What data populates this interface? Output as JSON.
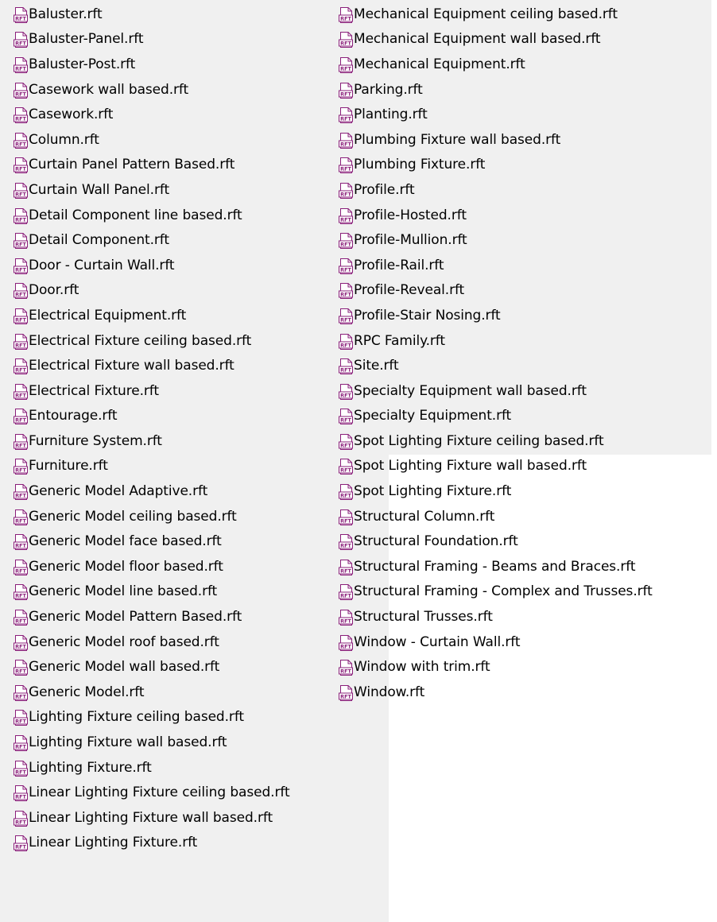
{
  "icon": {
    "name": "rft-file-icon",
    "badge": "RFT",
    "accent": "#8a1f7a"
  },
  "columns": [
    {
      "items": [
        "Baluster.rft",
        "Baluster-Panel.rft",
        "Baluster-Post.rft",
        "Casework wall based.rft",
        "Casework.rft",
        "Column.rft",
        "Curtain Panel Pattern Based.rft",
        "Curtain Wall Panel.rft",
        "Detail Component line based.rft",
        "Detail Component.rft",
        "Door - Curtain Wall.rft",
        "Door.rft",
        "Electrical Equipment.rft",
        "Electrical Fixture ceiling based.rft",
        "Electrical Fixture wall based.rft",
        "Electrical Fixture.rft",
        "Entourage.rft",
        "Furniture System.rft",
        "Furniture.rft",
        "Generic Model Adaptive.rft",
        "Generic Model ceiling based.rft",
        "Generic Model face based.rft",
        "Generic Model floor based.rft",
        "Generic Model line based.rft",
        "Generic Model Pattern Based.rft",
        "Generic Model roof based.rft",
        "Generic Model wall based.rft",
        "Generic Model.rft",
        "Lighting Fixture ceiling based.rft",
        "Lighting Fixture wall based.rft",
        "Lighting Fixture.rft",
        "Linear Lighting Fixture ceiling based.rft",
        "Linear Lighting Fixture wall based.rft",
        "Linear Lighting Fixture.rft"
      ]
    },
    {
      "items": [
        "Mechanical Equipment ceiling based.rft",
        "Mechanical Equipment wall based.rft",
        "Mechanical Equipment.rft",
        "Parking.rft",
        "Planting.rft",
        "Plumbing Fixture wall based.rft",
        "Plumbing Fixture.rft",
        "Profile.rft",
        "Profile-Hosted.rft",
        "Profile-Mullion.rft",
        "Profile-Rail.rft",
        "Profile-Reveal.rft",
        "Profile-Stair Nosing.rft",
        "RPC Family.rft",
        "Site.rft",
        "Specialty Equipment wall based.rft",
        "Specialty Equipment.rft",
        "Spot Lighting Fixture ceiling based.rft",
        "Spot Lighting Fixture wall based.rft",
        "Spot Lighting Fixture.rft",
        "Structural Column.rft",
        "Structural Foundation.rft",
        "Structural Framing - Beams and Braces.rft",
        "Structural Framing - Complex and Trusses.rft",
        "Structural Trusses.rft",
        "Window - Curtain Wall.rft",
        "Window with trim.rft",
        "Window.rft"
      ]
    }
  ]
}
